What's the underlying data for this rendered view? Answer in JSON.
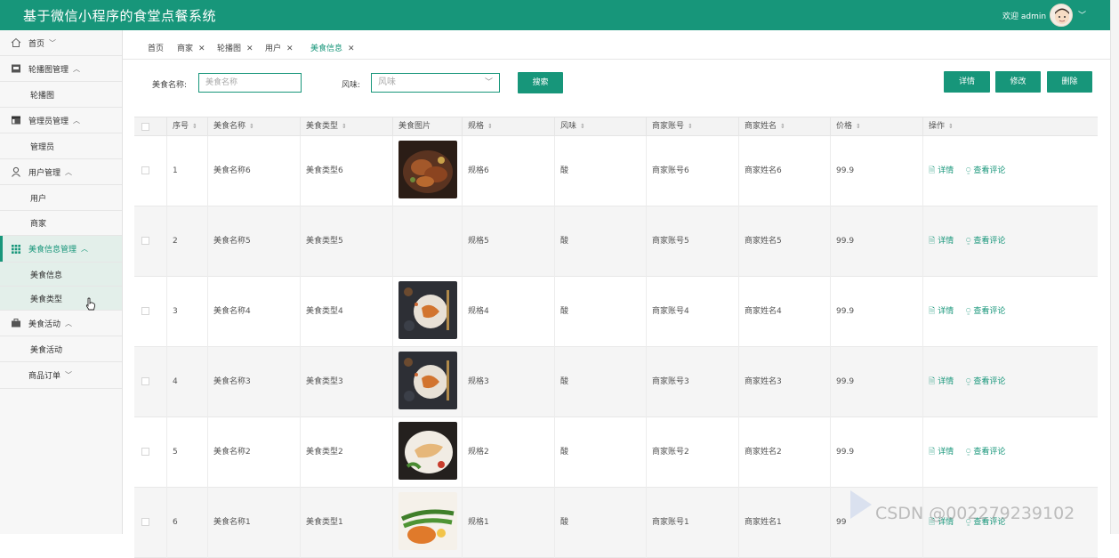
{
  "app": {
    "title": "基于微信小程序的食堂点餐系统",
    "welcome": "欢迎 admin",
    "accent": "#17967a"
  },
  "sidebar": {
    "items": [
      {
        "label": "首页",
        "icon": "home-icon",
        "chevron": "﹀"
      },
      {
        "label": "轮播图管理",
        "icon": "image-icon",
        "chevron": "︿"
      },
      {
        "label": "轮播图",
        "sub": true
      },
      {
        "label": "管理员管理",
        "icon": "layout-icon",
        "chevron": "︿"
      },
      {
        "label": "管理员",
        "sub": true
      },
      {
        "label": "用户管理",
        "icon": "user-icon",
        "chevron": "︿"
      },
      {
        "label": "用户",
        "sub": true
      },
      {
        "label": "商家",
        "sub": true
      },
      {
        "label": "美食信息管理",
        "icon": "grid-icon",
        "chevron": "︿",
        "active": true
      },
      {
        "label": "美食信息",
        "sub": true
      },
      {
        "label": "美食类型",
        "sub": true
      },
      {
        "label": "美食活动",
        "icon": "briefcase-icon",
        "chevron": "︿"
      },
      {
        "label": "美食活动",
        "sub": true
      },
      {
        "label": "商品订单",
        "chevron": "﹀"
      }
    ]
  },
  "tabs": [
    {
      "label": "首页",
      "closable": false
    },
    {
      "label": "商家",
      "closable": true
    },
    {
      "label": "轮播图",
      "closable": true
    },
    {
      "label": "用户",
      "closable": true
    },
    {
      "label": "美食信息",
      "closable": true,
      "active": true
    }
  ],
  "search": {
    "name_label": "美食名称:",
    "name_placeholder": "美食名称",
    "flavor_label": "风味:",
    "flavor_placeholder": "风味",
    "search_button": "搜索"
  },
  "actions": {
    "detail": "详情",
    "edit": "修改",
    "delete": "删除"
  },
  "table": {
    "columns": [
      "序号",
      "美食名称",
      "美食类型",
      "美食图片",
      "规格",
      "风味",
      "商家账号",
      "商家姓名",
      "价格",
      "操作"
    ],
    "op_detail": "详情",
    "op_review": "查看评论",
    "rows": [
      {
        "no": "1",
        "name": "美食名称6",
        "type": "美食类型6",
        "image": "grilled-meat",
        "spec": "规格6",
        "flavor": "酸",
        "account": "商家账号6",
        "merchant": "商家姓名6",
        "price": "99.9"
      },
      {
        "no": "2",
        "name": "美食名称5",
        "type": "美食类型5",
        "image": "none",
        "spec": "规格5",
        "flavor": "酸",
        "account": "商家账号5",
        "merchant": "商家姓名5",
        "price": "99.9"
      },
      {
        "no": "3",
        "name": "美食名称4",
        "type": "美食类型4",
        "image": "pasta-dark",
        "spec": "规格4",
        "flavor": "酸",
        "account": "商家账号4",
        "merchant": "商家姓名4",
        "price": "99.9"
      },
      {
        "no": "4",
        "name": "美食名称3",
        "type": "美食类型3",
        "image": "pasta-dark",
        "spec": "规格3",
        "flavor": "酸",
        "account": "商家账号3",
        "merchant": "商家姓名3",
        "price": "99.9"
      },
      {
        "no": "5",
        "name": "美食名称2",
        "type": "美食类型2",
        "image": "fish-plate",
        "spec": "规格2",
        "flavor": "酸",
        "account": "商家账号2",
        "merchant": "商家姓名2",
        "price": "99.9"
      },
      {
        "no": "6",
        "name": "美食名称1",
        "type": "美食类型1",
        "image": "steak-beans",
        "spec": "规格1",
        "flavor": "酸",
        "account": "商家账号1",
        "merchant": "商家姓名1",
        "price": "99"
      }
    ]
  },
  "watermark": "CSDN @002279239102"
}
